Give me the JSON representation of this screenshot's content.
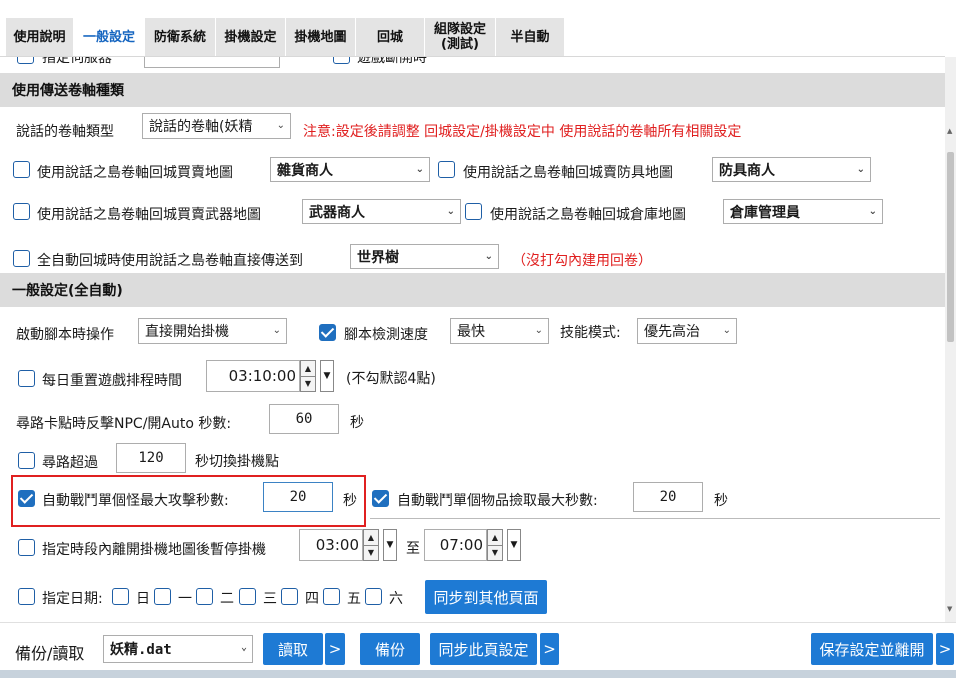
{
  "tabs": [
    {
      "label": "使用說明",
      "active": false
    },
    {
      "label": "一般設定",
      "active": true
    },
    {
      "label": "防衛系統",
      "active": false
    },
    {
      "label": "掛機設定",
      "active": false
    },
    {
      "label": "掛機地圖",
      "active": false
    },
    {
      "label": "回城",
      "active": false
    },
    {
      "label": "組隊設定\n(測試)",
      "active": false
    },
    {
      "label": "半自動",
      "active": false
    }
  ],
  "partial_top": {
    "label1": "指定伺服器",
    "label2": "遊戲斷開時"
  },
  "section_scroll": {
    "title": "使用傳送卷軸種類",
    "type_label": "說話的卷軸類型",
    "type_value": "說話的卷軸(妖精",
    "note": "注意:設定後請調整 回城設定/掛機設定中 使用說話的卷軸所有相關設定",
    "row1": {
      "label_a": "使用說話之島卷軸回城買賣地圖",
      "value_a": "雜貨商人",
      "label_b": "使用說話之島卷軸回城賣防具地圖",
      "value_b": "防具商人"
    },
    "row2": {
      "label_a": "使用說話之島卷軸回城買賣武器地圖",
      "value_a": "武器商人",
      "label_b": "使用說話之島卷軸回城倉庫地圖",
      "value_b": "倉庫管理員"
    },
    "row3": {
      "label": "全自動回城時使用說話之島卷軸直接傳送到",
      "value": "世界樹",
      "note": "（沒打勾內建用回卷）"
    }
  },
  "section_general": {
    "title": "一般設定(全自動)",
    "start_label": "啟動腳本時操作",
    "start_value": "直接開始掛機",
    "speed_label": "腳本檢測速度",
    "speed_value": "最快",
    "skill_label": "技能模式:",
    "skill_value": "優先高治",
    "reset_label": "每日重置遊戲排程時間",
    "reset_time": "03:10:00",
    "reset_note": "(不勾默認4點)",
    "stuck_label": "尋路卡點時反擊NPC/開Auto 秒數:",
    "stuck_value": "60",
    "sec_unit": "秒",
    "timeout_label": "尋路超過",
    "timeout_value": "120",
    "timeout_suffix": "秒切換掛機點",
    "attack_label": "自動戰鬥單個怪最大攻擊秒數:",
    "attack_value": "20",
    "pickup_label": "自動戰鬥單個物品撿取最大秒數:",
    "pickup_value": "20",
    "pause_label": "指定時段內離開掛機地圖後暫停掛機",
    "pause_start": "03:00",
    "pause_to": "至",
    "pause_end": "07:00",
    "date_label": "指定日期:",
    "days": [
      "日",
      "一",
      "二",
      "三",
      "四",
      "五",
      "六"
    ],
    "sync_other": "同步到其他頁面"
  },
  "bottom": {
    "backup_label": "備份/讀取",
    "file_value": "妖精.dat",
    "read": "讀取",
    "more": ">",
    "backup": "備份",
    "sync_page": "同步此頁設定",
    "save_exit": "保存設定並離開"
  },
  "colors": {
    "accent": "#1e7ad4",
    "warning": "#e02020",
    "highlight_box": "#e02020",
    "active_tab": "#1565c0"
  }
}
